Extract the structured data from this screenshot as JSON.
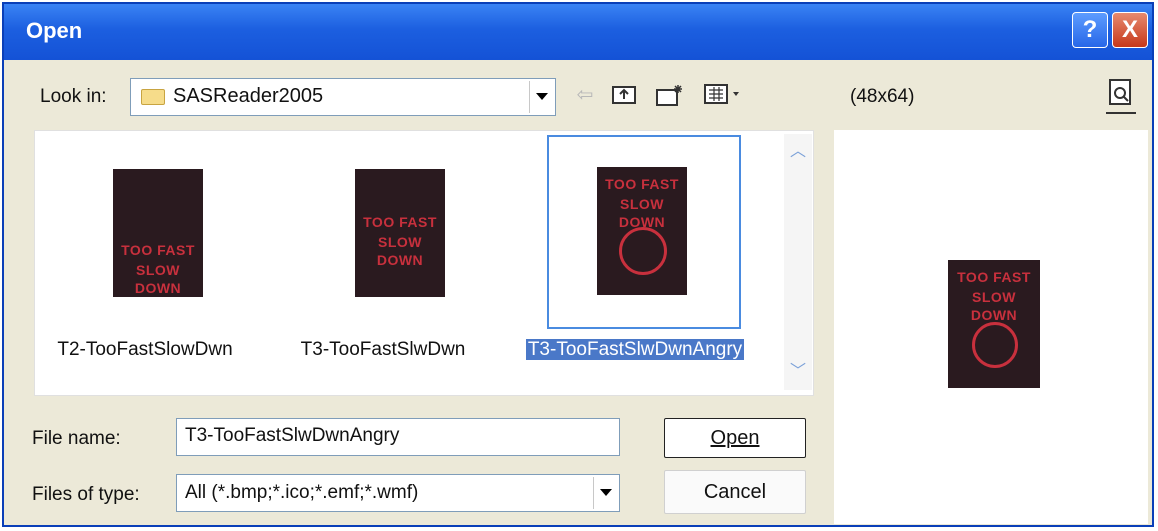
{
  "dialog": {
    "title": "Open",
    "help_button": "?",
    "close_button": "X"
  },
  "lookin": {
    "label": "Look in:",
    "value": "SASReader2005"
  },
  "toolbar": {
    "back_icon": "back-arrow-icon",
    "up_icon": "up-one-level-icon",
    "new_folder_icon": "new-folder-icon",
    "views_icon": "views-menu-icon",
    "preview_icon": "preview-icon"
  },
  "preview": {
    "size_label": "(48x64)",
    "thumb_lines": [
      "TOO FAST",
      "SLOW DOWN"
    ]
  },
  "files": [
    {
      "name": "T2-TooFastSlowDwn",
      "lines": [
        "TOO FAST",
        "SLOW DOWN"
      ],
      "face": false
    },
    {
      "name": "T3-TooFastSlwDwn",
      "lines": [
        "TOO FAST",
        "SLOW DOWN"
      ],
      "face": false
    },
    {
      "name": "T3-TooFastSlwDwnAngry",
      "lines": [
        "TOO FAST",
        "SLOW DOWN"
      ],
      "face": true,
      "selected": true
    }
  ],
  "filename": {
    "label": "File name:",
    "value": "T3-TooFastSlwDwnAngry"
  },
  "filetype": {
    "label": "Files of type:",
    "value": "All (*.bmp;*.ico;*.emf;*.wmf)"
  },
  "buttons": {
    "open": "Open",
    "cancel": "Cancel"
  },
  "colors": {
    "titlebar": "#1c5fe0",
    "sign_text": "#c8303d",
    "sign_bg": "#2a1a1f",
    "selection": "#4a78c8"
  }
}
